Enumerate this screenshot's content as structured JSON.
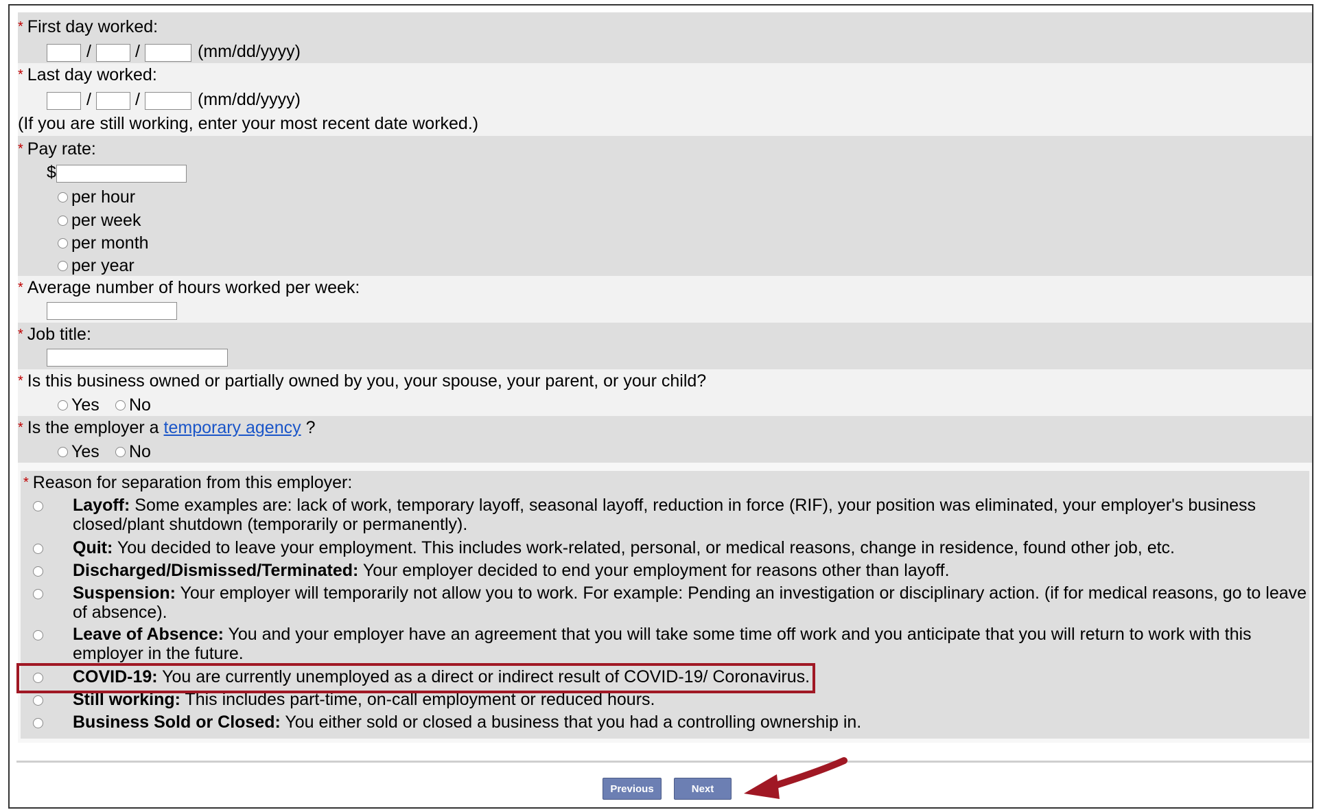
{
  "form": {
    "first_day_label": "First day worked:",
    "last_day_label": "Last day worked:",
    "date_format": "(mm/dd/yyyy)",
    "date_separator": "/",
    "still_working_note": "(If you are still working, enter your most recent date worked.)",
    "pay_rate_label": "Pay rate:",
    "currency_symbol": "$",
    "pay_options": [
      "per hour",
      "per week",
      "per month",
      "per year"
    ],
    "avg_hours_label": "Average number of hours worked per week:",
    "job_title_label": "Job title:",
    "business_owned_label": "Is this business owned or partially owned by you, your spouse, your parent, or your child?",
    "temp_agency_prefix": "Is the employer a ",
    "temp_agency_link": "temporary agency",
    "temp_agency_suffix": " ?",
    "yes_label": "Yes",
    "no_label": "No",
    "required_mark": "*"
  },
  "separation": {
    "label": "Reason for separation from this employer:",
    "reasons": [
      {
        "title": "Layoff:",
        "text": " Some examples are: lack of work, temporary layoff, seasonal layoff, reduction in force (RIF), your position was eliminated, your employer's business closed/plant shutdown (temporarily or permanently)."
      },
      {
        "title": "Quit:",
        "text": " You decided to leave your employment. This includes work-related, personal, or medical reasons, change in residence, found other job, etc."
      },
      {
        "title": "Discharged/Dismissed/Terminated:",
        "text": " Your employer decided to end your employment for reasons other than layoff."
      },
      {
        "title": "Suspension:",
        "text": " Your employer will temporarily not allow you to work. For example: Pending an investigation or disciplinary action. (if for medical reasons, go to leave of absence)."
      },
      {
        "title": "Leave of Absence:",
        "text": " You and your employer have an agreement that you will take some time off work and you anticipate that you will return to work with this employer in the future."
      },
      {
        "title": "COVID-19:",
        "text": " You are currently unemployed as a direct or indirect result of COVID-19/ Coronavirus."
      },
      {
        "title": "Still working:",
        "text": " This includes part-time, on-call employment or reduced hours."
      },
      {
        "title": "Business Sold or Closed:",
        "text": " You either sold or closed a business that you had a controlling ownership in."
      }
    ]
  },
  "buttons": {
    "previous": "Previous",
    "next": "Next"
  },
  "colors": {
    "highlight": "#a01824",
    "button": "#6c7fb3",
    "required": "#c00000",
    "link": "#1a55c8"
  }
}
